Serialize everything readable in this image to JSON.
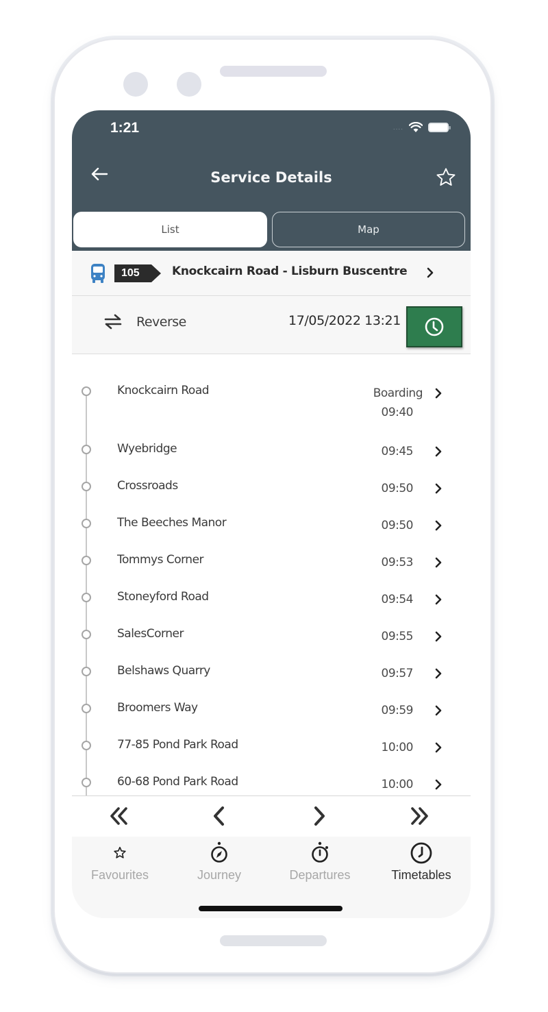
{
  "status_bar": {
    "time": "1:21",
    "signal": "....",
    "icons": [
      "wifi-icon",
      "battery-icon"
    ]
  },
  "header": {
    "back_icon": "arrow-left-icon",
    "title": "Service Details",
    "favourite_icon": "star-outline-icon"
  },
  "view_tabs": [
    {
      "label": "List",
      "selected": true
    },
    {
      "label": "Map",
      "selected": false
    }
  ],
  "route": {
    "icon": "bus-icon",
    "number": "105",
    "name": "Knockcairn Road - Lisburn Buscentre",
    "chevron": "chevron-right-icon",
    "icon_color": "#3d82c4"
  },
  "controls": {
    "reverse_label": "Reverse",
    "reverse_icon": "swap-arrows-icon",
    "datetime": "17/05/2022 13:21",
    "time_button_icon": "clock-icon",
    "time_button_color": "#2e7d4e"
  },
  "stops": [
    {
      "name": "Knockcairn Road",
      "status": "Boarding",
      "time": "09:40"
    },
    {
      "name": "Wyebridge",
      "time": "09:45"
    },
    {
      "name": "Crossroads",
      "time": "09:50"
    },
    {
      "name": "The Beeches Manor",
      "time": "09:50"
    },
    {
      "name": "Tommys Corner",
      "time": "09:53"
    },
    {
      "name": "Stoneyford Road",
      "time": "09:54"
    },
    {
      "name": "SalesCorner",
      "time": "09:55"
    },
    {
      "name": "Belshaws Quarry",
      "time": "09:57"
    },
    {
      "name": "Broomers Way",
      "time": "09:59"
    },
    {
      "name": "77-85 Pond Park Road",
      "time": "10:00"
    },
    {
      "name": "60-68 Pond Park Road",
      "time": "10:00"
    }
  ],
  "pager": {
    "first_icon": "double-chevron-left-icon",
    "prev_icon": "chevron-left-icon",
    "next_icon": "chevron-right-icon",
    "last_icon": "double-chevron-right-icon"
  },
  "tabbar": [
    {
      "label": "Favourites",
      "icon": "star-icon",
      "active": false
    },
    {
      "label": "Journey",
      "icon": "compass-icon",
      "active": false
    },
    {
      "label": "Departures",
      "icon": "stopwatch-icon",
      "active": false
    },
    {
      "label": "Timetables",
      "icon": "clock-icon",
      "active": true
    }
  ],
  "colors": {
    "header_bg": "#45555f",
    "accent_green": "#2e7d4e",
    "bus_blue": "#3d82c4"
  }
}
